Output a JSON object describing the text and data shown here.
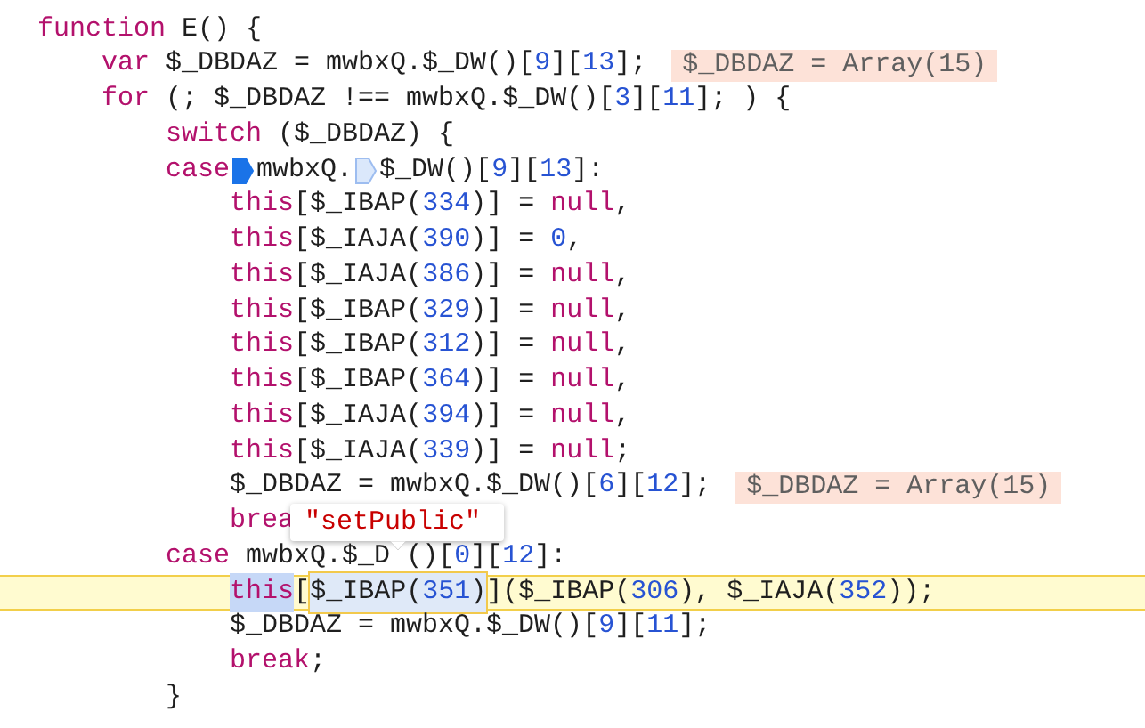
{
  "lines": [
    {
      "current": false,
      "segments": [
        {
          "kind": "code",
          "tokens": [
            {
              "kind": "keyword",
              "text": "function"
            },
            {
              "kind": "plain",
              "text": " E() {"
            }
          ]
        }
      ]
    },
    {
      "current": false,
      "segments": [
        {
          "kind": "code",
          "tokens": [
            {
              "kind": "keyword",
              "text": "    var"
            },
            {
              "kind": "plain",
              "text": " $_DBDAZ = mwbxQ.$_DW()["
            },
            {
              "kind": "number",
              "text": "9"
            },
            {
              "kind": "plain",
              "text": "]["
            },
            {
              "kind": "number",
              "text": "13"
            },
            {
              "kind": "plain",
              "text": "];"
            }
          ]
        },
        {
          "kind": "inline_value",
          "text": "$_DBDAZ = Array(15)"
        }
      ]
    },
    {
      "current": false,
      "segments": [
        {
          "kind": "code",
          "tokens": [
            {
              "kind": "keyword",
              "text": "    for"
            },
            {
              "kind": "plain",
              "text": " (; $_DBDAZ !== mwbxQ.$_DW()["
            },
            {
              "kind": "number",
              "text": "3"
            },
            {
              "kind": "plain",
              "text": "]["
            },
            {
              "kind": "number",
              "text": "11"
            },
            {
              "kind": "plain",
              "text": "]; ) {"
            }
          ]
        }
      ]
    },
    {
      "current": false,
      "segments": [
        {
          "kind": "code",
          "tokens": [
            {
              "kind": "keyword",
              "text": "        switch"
            },
            {
              "kind": "plain",
              "text": " ($_DBDAZ) {"
            }
          ]
        }
      ]
    },
    {
      "current": false,
      "segments": [
        {
          "kind": "code",
          "tokens": [
            {
              "kind": "keyword",
              "text": "        case"
            }
          ]
        },
        {
          "kind": "marker",
          "active": true
        },
        {
          "kind": "code",
          "tokens": [
            {
              "kind": "plain",
              "text": "mwbxQ."
            }
          ]
        },
        {
          "kind": "marker",
          "active": false
        },
        {
          "kind": "code",
          "tokens": [
            {
              "kind": "plain",
              "text": "$_DW()["
            },
            {
              "kind": "number",
              "text": "9"
            },
            {
              "kind": "plain",
              "text": "]["
            },
            {
              "kind": "number",
              "text": "13"
            },
            {
              "kind": "plain",
              "text": "]:"
            }
          ]
        }
      ]
    },
    {
      "current": false,
      "segments": [
        {
          "kind": "code",
          "tokens": [
            {
              "kind": "keyword",
              "text": "            this"
            },
            {
              "kind": "plain",
              "text": "[$_IBAP("
            },
            {
              "kind": "number",
              "text": "334"
            },
            {
              "kind": "plain",
              "text": ")] = "
            },
            {
              "kind": "keyword",
              "text": "null"
            },
            {
              "kind": "plain",
              "text": ","
            }
          ]
        }
      ]
    },
    {
      "current": false,
      "segments": [
        {
          "kind": "code",
          "tokens": [
            {
              "kind": "keyword",
              "text": "            this"
            },
            {
              "kind": "plain",
              "text": "[$_IAJA("
            },
            {
              "kind": "number",
              "text": "390"
            },
            {
              "kind": "plain",
              "text": ")] = "
            },
            {
              "kind": "number",
              "text": "0"
            },
            {
              "kind": "plain",
              "text": ","
            }
          ]
        }
      ]
    },
    {
      "current": false,
      "segments": [
        {
          "kind": "code",
          "tokens": [
            {
              "kind": "keyword",
              "text": "            this"
            },
            {
              "kind": "plain",
              "text": "[$_IAJA("
            },
            {
              "kind": "number",
              "text": "386"
            },
            {
              "kind": "plain",
              "text": ")] = "
            },
            {
              "kind": "keyword",
              "text": "null"
            },
            {
              "kind": "plain",
              "text": ","
            }
          ]
        }
      ]
    },
    {
      "current": false,
      "segments": [
        {
          "kind": "code",
          "tokens": [
            {
              "kind": "keyword",
              "text": "            this"
            },
            {
              "kind": "plain",
              "text": "[$_IBAP("
            },
            {
              "kind": "number",
              "text": "329"
            },
            {
              "kind": "plain",
              "text": ")] = "
            },
            {
              "kind": "keyword",
              "text": "null"
            },
            {
              "kind": "plain",
              "text": ","
            }
          ]
        }
      ]
    },
    {
      "current": false,
      "segments": [
        {
          "kind": "code",
          "tokens": [
            {
              "kind": "keyword",
              "text": "            this"
            },
            {
              "kind": "plain",
              "text": "[$_IBAP("
            },
            {
              "kind": "number",
              "text": "312"
            },
            {
              "kind": "plain",
              "text": ")] = "
            },
            {
              "kind": "keyword",
              "text": "null"
            },
            {
              "kind": "plain",
              "text": ","
            }
          ]
        }
      ]
    },
    {
      "current": false,
      "segments": [
        {
          "kind": "code",
          "tokens": [
            {
              "kind": "keyword",
              "text": "            this"
            },
            {
              "kind": "plain",
              "text": "[$_IBAP("
            },
            {
              "kind": "number",
              "text": "364"
            },
            {
              "kind": "plain",
              "text": ")] = "
            },
            {
              "kind": "keyword",
              "text": "null"
            },
            {
              "kind": "plain",
              "text": ","
            }
          ]
        }
      ]
    },
    {
      "current": false,
      "segments": [
        {
          "kind": "code",
          "tokens": [
            {
              "kind": "keyword",
              "text": "            this"
            },
            {
              "kind": "plain",
              "text": "[$_IAJA("
            },
            {
              "kind": "number",
              "text": "394"
            },
            {
              "kind": "plain",
              "text": ")] = "
            },
            {
              "kind": "keyword",
              "text": "null"
            },
            {
              "kind": "plain",
              "text": ","
            }
          ]
        }
      ]
    },
    {
      "current": false,
      "segments": [
        {
          "kind": "code",
          "tokens": [
            {
              "kind": "keyword",
              "text": "            this"
            },
            {
              "kind": "plain",
              "text": "[$_IAJA("
            },
            {
              "kind": "number",
              "text": "339"
            },
            {
              "kind": "plain",
              "text": ")] = "
            },
            {
              "kind": "keyword",
              "text": "null"
            },
            {
              "kind": "plain",
              "text": ";"
            }
          ]
        }
      ]
    },
    {
      "current": false,
      "segments": [
        {
          "kind": "code",
          "tokens": [
            {
              "kind": "plain",
              "text": "            $_DBDAZ = mwbxQ.$_DW()["
            },
            {
              "kind": "number",
              "text": "6"
            },
            {
              "kind": "plain",
              "text": "]["
            },
            {
              "kind": "number",
              "text": "12"
            },
            {
              "kind": "plain",
              "text": "];"
            }
          ]
        },
        {
          "kind": "inline_value",
          "text": "$_DBDAZ = Array(15)"
        }
      ]
    },
    {
      "current": false,
      "segments": [
        {
          "kind": "code",
          "tokens": [
            {
              "kind": "keyword",
              "text": "            brea"
            }
          ]
        }
      ]
    },
    {
      "current": false,
      "segments": [
        {
          "kind": "code",
          "tokens": [
            {
              "kind": "keyword",
              "text": "        case"
            },
            {
              "kind": "plain",
              "text": " mwbxQ.$_D"
            }
          ]
        },
        {
          "kind": "code",
          "tokens": [
            {
              "kind": "plain",
              "text": " ()["
            },
            {
              "kind": "number",
              "text": "0"
            },
            {
              "kind": "plain",
              "text": "]["
            },
            {
              "kind": "number",
              "text": "12"
            },
            {
              "kind": "plain",
              "text": "]:"
            }
          ]
        }
      ]
    },
    {
      "current": true,
      "segments": [
        {
          "kind": "selection",
          "tokens": [
            {
              "kind": "keyword",
              "text": "            this"
            }
          ]
        },
        {
          "kind": "code",
          "tokens": [
            {
              "kind": "plain",
              "text": "["
            }
          ]
        },
        {
          "kind": "evaluated",
          "tokens": [
            {
              "kind": "plain",
              "text": "$_IBAP("
            },
            {
              "kind": "number",
              "text": "351"
            },
            {
              "kind": "plain",
              "text": ")"
            }
          ]
        },
        {
          "kind": "code",
          "tokens": [
            {
              "kind": "plain",
              "text": "]($_IBAP("
            },
            {
              "kind": "number",
              "text": "306"
            },
            {
              "kind": "plain",
              "text": "), $_IAJA("
            },
            {
              "kind": "number",
              "text": "352"
            },
            {
              "kind": "plain",
              "text": "));"
            }
          ]
        }
      ]
    },
    {
      "current": false,
      "segments": [
        {
          "kind": "code",
          "tokens": [
            {
              "kind": "plain",
              "text": "            $_DBDAZ = mwbxQ.$_DW()["
            },
            {
              "kind": "number",
              "text": "9"
            },
            {
              "kind": "plain",
              "text": "]["
            },
            {
              "kind": "number",
              "text": "11"
            },
            {
              "kind": "plain",
              "text": "];"
            }
          ]
        }
      ]
    },
    {
      "current": false,
      "segments": [
        {
          "kind": "code",
          "tokens": [
            {
              "kind": "keyword",
              "text": "            break"
            },
            {
              "kind": "plain",
              "text": ";"
            }
          ]
        }
      ]
    },
    {
      "current": false,
      "segments": [
        {
          "kind": "code",
          "tokens": [
            {
              "kind": "plain",
              "text": "        }"
            }
          ]
        }
      ]
    }
  ],
  "tooltip": {
    "text": "\"setPublic\""
  }
}
